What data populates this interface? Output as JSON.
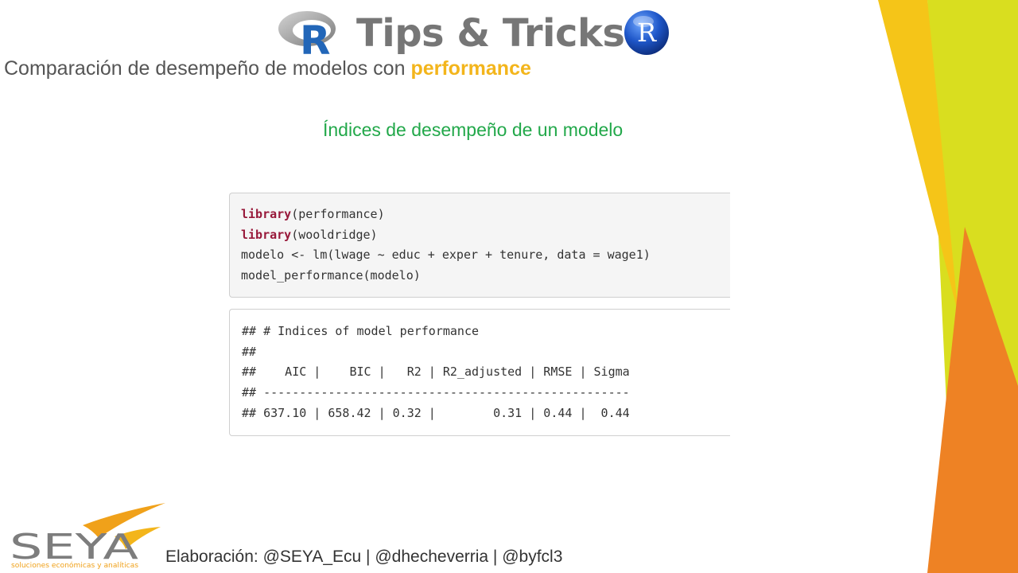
{
  "header": {
    "title": "Tips & Tricks",
    "r_letter": "R"
  },
  "subtitle": {
    "prefix": "Comparación de desempeño de modelos con ",
    "highlight": "performance"
  },
  "section_title": "Índices de desempeño de un modelo",
  "code_input": {
    "line1": {
      "func": "library",
      "rest": "(performance)"
    },
    "line2": {
      "func": "library",
      "rest": "(wooldridge)"
    },
    "line3": "modelo <- lm(lwage ~ educ + exper + tenure, data = wage1)",
    "line4": "model_performance(modelo)"
  },
  "code_output": {
    "line1": "## # Indices of model performance",
    "line2": "##",
    "line3": "##    AIC |    BIC |   R2 | R2_adjusted | RMSE | Sigma",
    "line4": "## ---------------------------------------------------",
    "line5": "## 637.10 | 658.42 | 0.32 |        0.31 | 0.44 |  0.44"
  },
  "logo": {
    "name": "SEYA",
    "tagline": "soluciones económicas y analíticas"
  },
  "footer": "Elaboración: @SEYA_Ecu | @dhecheverria | @byfcl3",
  "colors": {
    "accent_yellow": "#f3b51b",
    "section_green": "#22a84a",
    "keyword": "#98193a",
    "stripe_yellow": "#f5c518",
    "stripe_lime": "#d9de1f",
    "stripe_orange": "#ee8224"
  }
}
